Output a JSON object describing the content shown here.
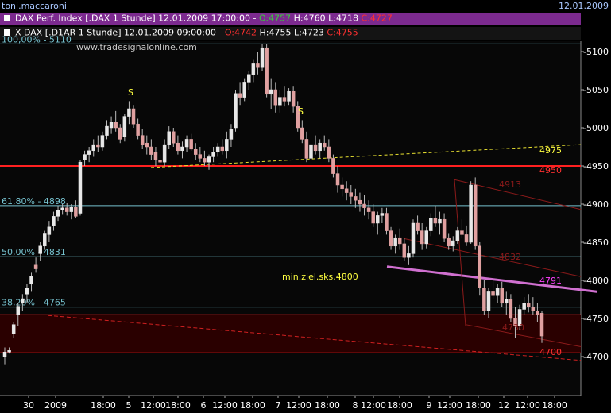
{
  "header": {
    "user": "toni.maccaroni",
    "date": "12.01.2009",
    "currency": "€"
  },
  "legend": [
    {
      "name": "DAX Perf. Index [.DAX  1 Stunde] 12.01.2009 17:00:00 -",
      "open": "O:4757",
      "high": "H:4760",
      "low": "L:4718",
      "close": "C:4727",
      "swatch": "#ffffff"
    },
    {
      "name": "X-DAX [.D1AR  1 Stunde] 12.01.2009 09:00:00 -",
      "open": "O:4742",
      "high": "H:4755",
      "low": "L:4723",
      "close": "C:4755",
      "swatch": "#ffffff"
    }
  ],
  "watermark": "www.tradesignalonline.com",
  "chart_data": {
    "type": "candlestick",
    "title": "DAX Perf. Index [.DAX 1 Stunde]",
    "ylim": [
      4680,
      5120
    ],
    "y_ticks": [
      4700,
      4750,
      4800,
      4850,
      4900,
      4950,
      5000,
      5050,
      5100
    ],
    "x_ticks": [
      "30",
      "2009",
      "18:00",
      "5",
      "12:00",
      "18:00",
      "6",
      "12:00",
      "18:00",
      "7",
      "12:00",
      "18:00",
      "8",
      "12:00",
      "18:00",
      "9",
      "12:00",
      "18:00",
      "12",
      "12:00",
      "18:00"
    ],
    "candles": [
      [
        4700,
        4712,
        4690,
        4706
      ],
      [
        4706,
        4712,
        4704,
        4708
      ],
      [
        4730,
        4745,
        4725,
        4742
      ],
      [
        4755,
        4770,
        4740,
        4766
      ],
      [
        4770,
        4782,
        4760,
        4776
      ],
      [
        4782,
        4795,
        4770,
        4790
      ],
      [
        4795,
        4810,
        4785,
        4805
      ],
      [
        4820,
        4830,
        4810,
        4815
      ],
      [
        4835,
        4850,
        4825,
        4845
      ],
      [
        4845,
        4865,
        4840,
        4862
      ],
      [
        4860,
        4878,
        4850,
        4870
      ],
      [
        4872,
        4890,
        4865,
        4884
      ],
      [
        4884,
        4898,
        4878,
        4892
      ],
      [
        4892,
        4900,
        4886,
        4895
      ],
      [
        4895,
        4902,
        4885,
        4890
      ],
      [
        4890,
        4900,
        4880,
        4896
      ],
      [
        4896,
        4905,
        4882,
        4884
      ],
      [
        4888,
        4958,
        4885,
        4955
      ],
      [
        4958,
        4970,
        4950,
        4965
      ],
      [
        4965,
        4975,
        4955,
        4970
      ],
      [
        4970,
        4985,
        4962,
        4978
      ],
      [
        4978,
        4990,
        4968,
        4975
      ],
      [
        4975,
        4995,
        4970,
        4990
      ],
      [
        4990,
        5010,
        4985,
        5002
      ],
      [
        5000,
        5015,
        4992,
        5008
      ],
      [
        5008,
        5022,
        4995,
        5000
      ],
      [
        5000,
        5005,
        4980,
        4985
      ],
      [
        4988,
        5018,
        4982,
        5015
      ],
      [
        5015,
        5035,
        5005,
        5025
      ],
      [
        5025,
        5030,
        5000,
        5005
      ],
      [
        5005,
        5012,
        4985,
        4990
      ],
      [
        4990,
        4998,
        4972,
        4978
      ],
      [
        4980,
        4990,
        4965,
        4975
      ],
      [
        4975,
        4985,
        4958,
        4965
      ],
      [
        4968,
        4975,
        4950,
        4958
      ],
      [
        4958,
        4965,
        4948,
        4955
      ],
      [
        4955,
        4985,
        4950,
        4978
      ],
      [
        4978,
        5002,
        4972,
        4995
      ],
      [
        4995,
        5000,
        4975,
        4980
      ],
      [
        4980,
        4990,
        4965,
        4970
      ],
      [
        4970,
        4982,
        4960,
        4975
      ],
      [
        4975,
        4990,
        4968,
        4985
      ],
      [
        4985,
        4992,
        4970,
        4972
      ],
      [
        4972,
        4980,
        4958,
        4965
      ],
      [
        4965,
        4975,
        4955,
        4960
      ],
      [
        4960,
        4970,
        4950,
        4955
      ],
      [
        4955,
        4965,
        4945,
        4962
      ],
      [
        4962,
        4975,
        4955,
        4968
      ],
      [
        4968,
        4980,
        4962,
        4975
      ],
      [
        4975,
        4985,
        4965,
        4970
      ],
      [
        4970,
        4995,
        4960,
        4985
      ],
      [
        4985,
        5005,
        4975,
        4998
      ],
      [
        5000,
        5050,
        4995,
        5045
      ],
      [
        5045,
        5060,
        5030,
        5040
      ],
      [
        5040,
        5065,
        5035,
        5060
      ],
      [
        5060,
        5075,
        5050,
        5070
      ],
      [
        5070,
        5090,
        5060,
        5085
      ],
      [
        5085,
        5100,
        5070,
        5080
      ],
      [
        5080,
        5110,
        5075,
        5105
      ],
      [
        5105,
        5110,
        5040,
        5045
      ],
      [
        5045,
        5065,
        5025,
        5050
      ],
      [
        5050,
        5060,
        5020,
        5030
      ],
      [
        5030,
        5050,
        5020,
        5040
      ],
      [
        5040,
        5055,
        5028,
        5035
      ],
      [
        5035,
        5052,
        5030,
        5048
      ],
      [
        5048,
        5055,
        5020,
        5028
      ],
      [
        5028,
        5035,
        4995,
        5000
      ],
      [
        5000,
        5010,
        4980,
        4985
      ],
      [
        4985,
        4995,
        4955,
        4960
      ],
      [
        4960,
        4985,
        4955,
        4978
      ],
      [
        4978,
        4990,
        4965,
        4970
      ],
      [
        4970,
        4985,
        4960,
        4980
      ],
      [
        4980,
        4990,
        4970,
        4975
      ],
      [
        4975,
        4985,
        4955,
        4960
      ],
      [
        4960,
        4965,
        4935,
        4940
      ],
      [
        4940,
        4950,
        4915,
        4925
      ],
      [
        4925,
        4935,
        4910,
        4920
      ],
      [
        4920,
        4930,
        4905,
        4915
      ],
      [
        4915,
        4925,
        4900,
        4910
      ],
      [
        4910,
        4920,
        4895,
        4905
      ],
      [
        4905,
        4915,
        4890,
        4900
      ],
      [
        4900,
        4912,
        4885,
        4895
      ],
      [
        4895,
        4905,
        4880,
        4890
      ],
      [
        4890,
        4900,
        4870,
        4875
      ],
      [
        4875,
        4890,
        4860,
        4885
      ],
      [
        4885,
        4895,
        4875,
        4888
      ],
      [
        4888,
        4895,
        4860,
        4865
      ],
      [
        4865,
        4870,
        4840,
        4845
      ],
      [
        4845,
        4860,
        4835,
        4855
      ],
      [
        4855,
        4868,
        4840,
        4848
      ],
      [
        4848,
        4855,
        4825,
        4830
      ],
      [
        4830,
        4845,
        4820,
        4835
      ],
      [
        4835,
        4880,
        4830,
        4875
      ],
      [
        4875,
        4885,
        4860,
        4865
      ],
      [
        4865,
        4875,
        4840,
        4848
      ],
      [
        4848,
        4870,
        4842,
        4865
      ],
      [
        4865,
        4888,
        4858,
        4882
      ],
      [
        4882,
        4898,
        4870,
        4875
      ],
      [
        4875,
        4890,
        4860,
        4880
      ],
      [
        4880,
        4888,
        4850,
        4855
      ],
      [
        4855,
        4862,
        4840,
        4845
      ],
      [
        4845,
        4858,
        4838,
        4852
      ],
      [
        4852,
        4870,
        4848,
        4865
      ],
      [
        4865,
        4880,
        4855,
        4860
      ],
      [
        4860,
        4872,
        4845,
        4850
      ],
      [
        4850,
        4930,
        4848,
        4925
      ],
      [
        4925,
        4935,
        4840,
        4845
      ],
      [
        4845,
        4850,
        4780,
        4790
      ],
      [
        4790,
        4800,
        4755,
        4760
      ],
      [
        4760,
        4790,
        4750,
        4785
      ],
      [
        4785,
        4800,
        4775,
        4780
      ],
      [
        4780,
        4795,
        4770,
        4790
      ],
      [
        4790,
        4798,
        4765,
        4770
      ],
      [
        4770,
        4785,
        4755,
        4775
      ],
      [
        4775,
        4782,
        4745,
        4750
      ],
      [
        4750,
        4765,
        4725,
        4740
      ],
      [
        4740,
        4768,
        4735,
        4762
      ],
      [
        4762,
        4778,
        4755,
        4770
      ],
      [
        4770,
        4782,
        4758,
        4765
      ],
      [
        4765,
        4778,
        4755,
        4760
      ],
      [
        4760,
        4770,
        4745,
        4755
      ],
      [
        4757,
        4760,
        4718,
        4727
      ]
    ],
    "horizontal_lines": [
      {
        "value": 5110,
        "label": "100,00% - 5110",
        "color": "#76c2cf"
      },
      {
        "value": 4898,
        "label": "61,80% - 4898",
        "color": "#76c2cf"
      },
      {
        "value": 4831,
        "label": "50,00% - 4831",
        "color": "#76c2cf"
      },
      {
        "value": 4765,
        "label": "38,20% - 4765",
        "color": "#76c2cf"
      },
      {
        "value": 4950,
        "label": "4950",
        "color": "#ff2020"
      },
      {
        "value": 4755,
        "label": "",
        "color": "#ff2020"
      },
      {
        "value": 4705,
        "label": "",
        "color": "#ff2020"
      }
    ],
    "annotations": [
      {
        "text": "S",
        "color": "#ffff40"
      },
      {
        "text": "S",
        "color": "#ffff40"
      },
      {
        "text": "4975",
        "color": "#ffff40"
      },
      {
        "text": "4950",
        "color": "#ff3030"
      },
      {
        "text": "4913",
        "color": "#8b1a1a"
      },
      {
        "text": "4832",
        "color": "#8b1a1a"
      },
      {
        "text": "4791",
        "color": "#ff40ff"
      },
      {
        "text": "4730",
        "color": "#8b1a1a"
      },
      {
        "text": "4700",
        "color": "#ff3030"
      },
      {
        "text": "min.ziel.sks.4800",
        "color": "#ffff40"
      }
    ],
    "colors": {
      "up": "#e8e8e8",
      "down": "#e0a0a0",
      "background": "#000000",
      "zone": "#2a0000"
    }
  }
}
